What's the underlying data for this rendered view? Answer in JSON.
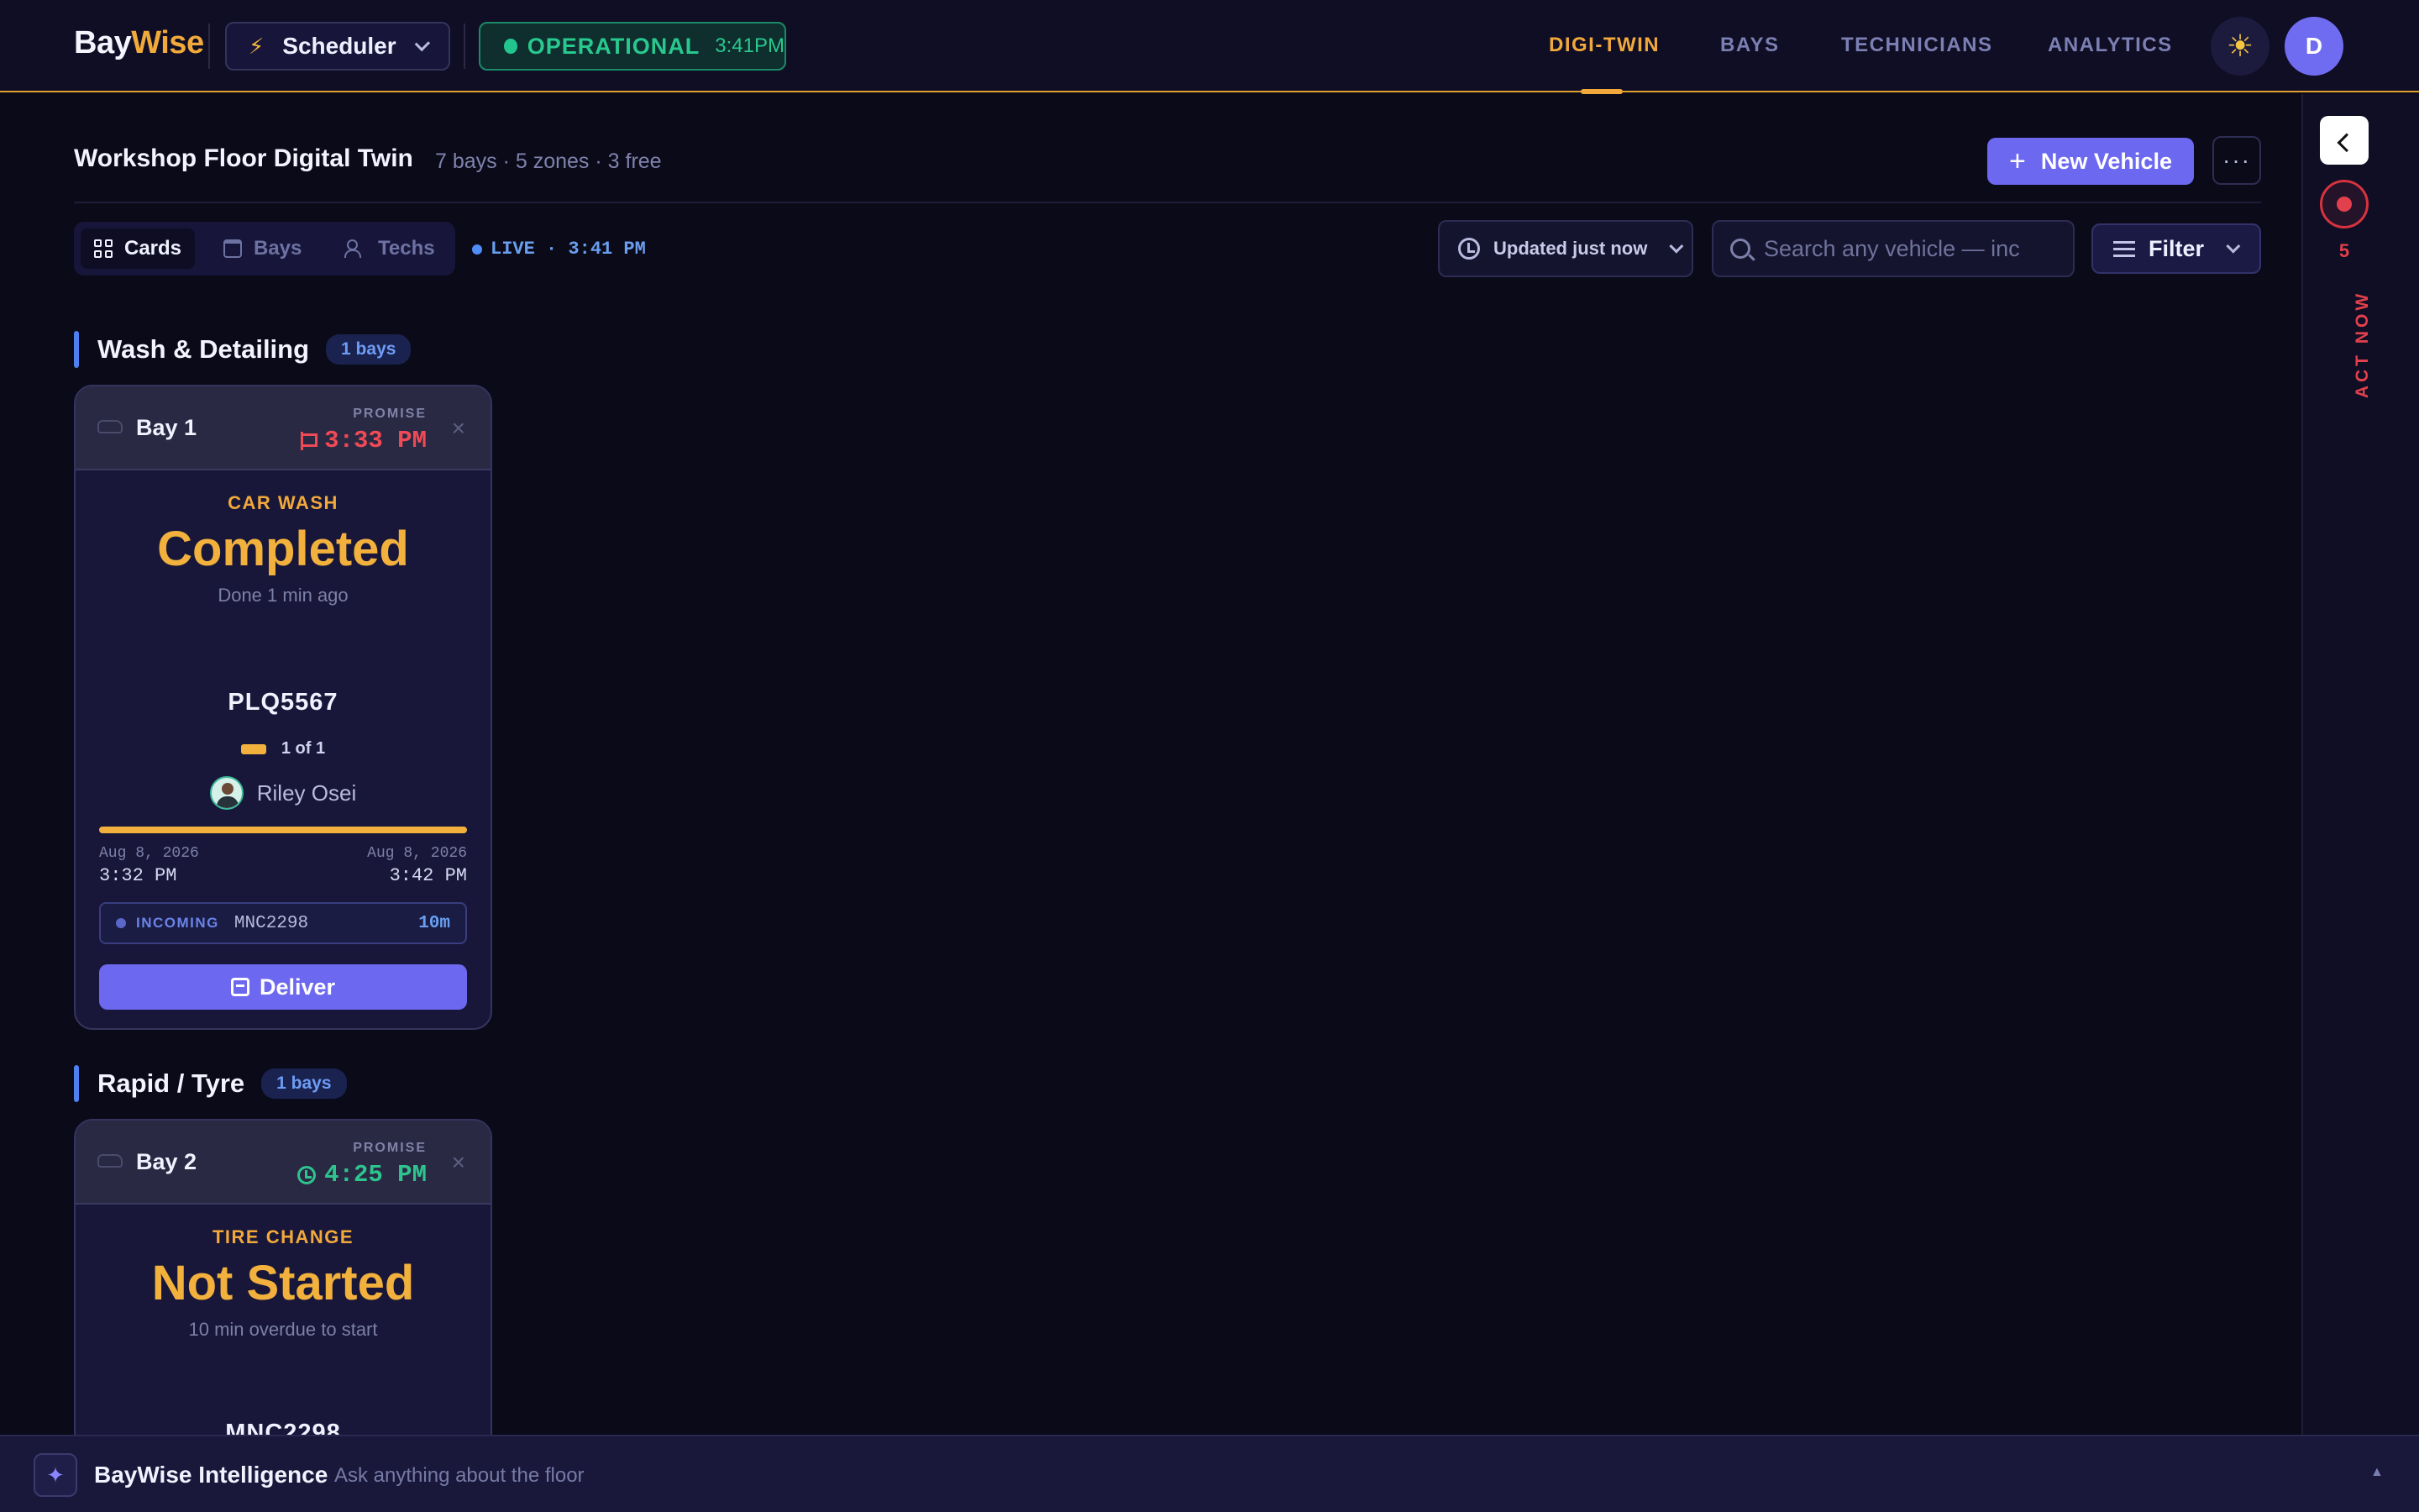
{
  "brand": {
    "part1": "Bay",
    "part2": "Wise"
  },
  "workspace": {
    "label": "Scheduler",
    "icon": "bolt-icon"
  },
  "system_status": {
    "label": "OPERATIONAL",
    "time": "3:41PM",
    "color": "#22c58d"
  },
  "nav": [
    {
      "label": "DIGI-TWIN",
      "active": true
    },
    {
      "label": "BAYS",
      "active": false
    },
    {
      "label": "TECHNICIANS",
      "active": false
    },
    {
      "label": "ANALYTICS",
      "active": false
    }
  ],
  "user": {
    "initial": "D"
  },
  "page": {
    "title": "Workshop Floor Digital Twin",
    "subtitle": "7 bays · 5 zones · 3 free",
    "new_vehicle_label": "New Vehicle",
    "more_label": "···"
  },
  "view_tabs": [
    {
      "label": "Cards",
      "icon": "grid-icon",
      "active": true
    },
    {
      "label": "Bays",
      "icon": "calendar-icon",
      "active": false
    },
    {
      "label": "Techs",
      "icon": "users-icon",
      "active": false
    }
  ],
  "live": "LIVE · 3:41 PM",
  "updated_label": "Updated just now",
  "search": {
    "placeholder": "Search any vehicle — inc",
    "value": ""
  },
  "filter_label": "Filter",
  "rail": {
    "count": "5",
    "label": "ACT NOW"
  },
  "zones": [
    {
      "name": "Wash & Detailing",
      "count": "1 bays",
      "card": {
        "bay": "Bay 1",
        "promise_label": "PROMISE",
        "promise_time": "3:33 PM",
        "promise_state": "overdue",
        "service": "CAR WASH",
        "status": "Completed",
        "status_detail": "Done 1 min ago",
        "plate": "PLQ5567",
        "job_count": "1 of 1",
        "technician": "Riley Osei",
        "progress": 1.0,
        "start_date": "Aug 8, 2026",
        "start_time": "3:32 PM",
        "end_date": "Aug 8, 2026",
        "end_time": "3:42 PM",
        "incoming_label": "INCOMING",
        "incoming_plate": "MNC2298",
        "incoming_eta": "10m",
        "action_label": "Deliver"
      }
    },
    {
      "name": "Rapid / Tyre",
      "count": "1 bays",
      "card": {
        "bay": "Bay 2",
        "promise_label": "PROMISE",
        "promise_time": "4:25 PM",
        "promise_state": "on-time",
        "service": "TIRE CHANGE",
        "status": "Not Started",
        "status_detail": "10 min overdue to start",
        "plate": "MNC2298"
      }
    }
  ],
  "assistant": {
    "title": "BayWise Intelligence",
    "placeholder": "Ask anything about the floor"
  }
}
